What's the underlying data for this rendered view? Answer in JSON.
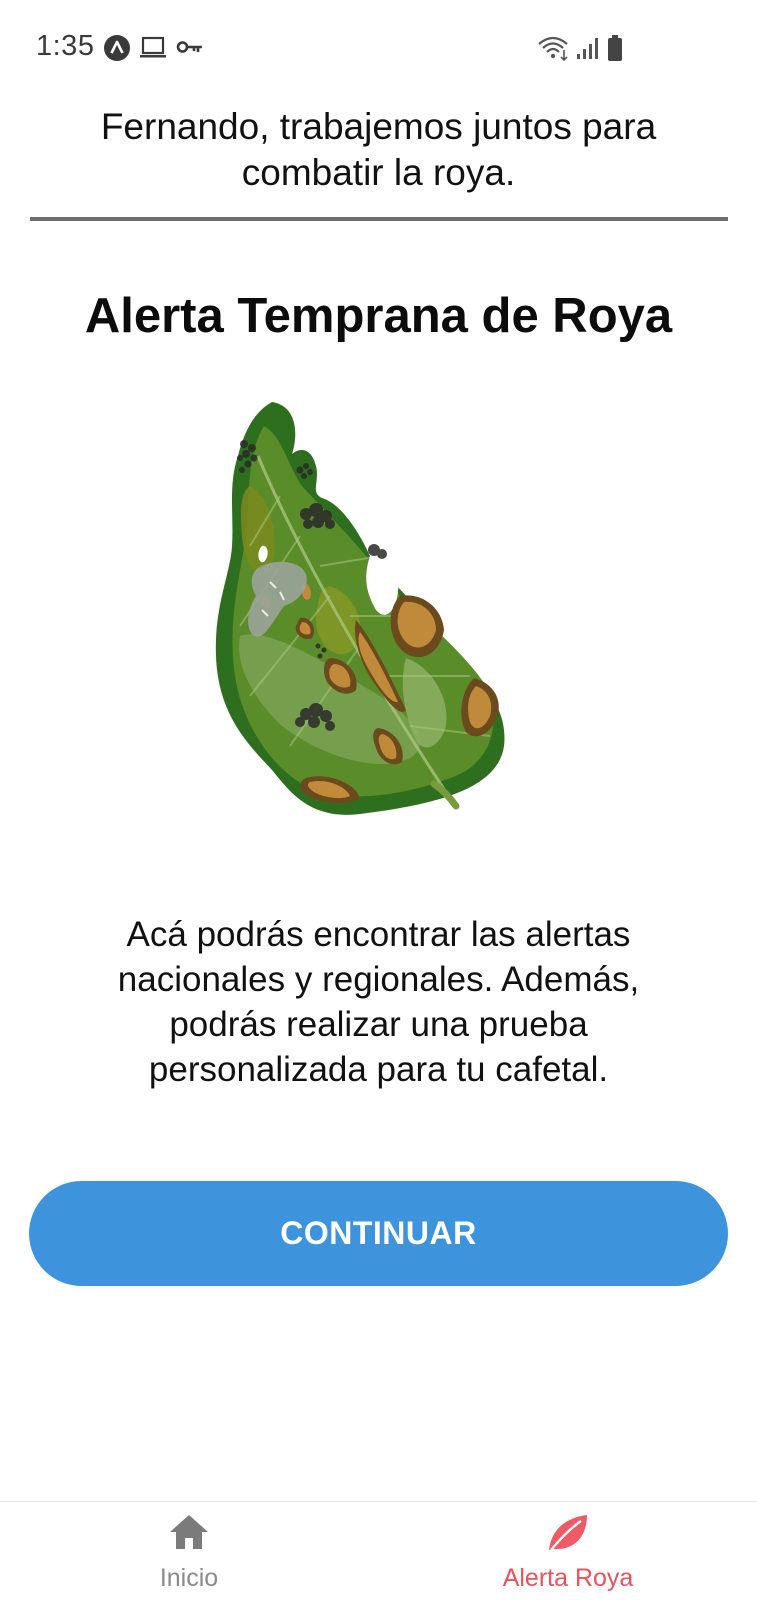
{
  "status_bar": {
    "time": "1:35",
    "icons": [
      "app-notification-icon",
      "laptop-icon",
      "vpn-key-icon",
      "wifi-icon",
      "signal-icon",
      "battery-icon"
    ]
  },
  "header": {
    "greeting": "Fernando, trabajemos juntos para combatir la roya."
  },
  "main": {
    "title": "Alerta Temprana de Roya",
    "illustration_icon": "coffee-leaf-rust-illustration",
    "description": "Acá podrás encontrar las alertas nacionales y regionales. Además, podrás realizar una prueba personalizada para tu cafetal.",
    "continue_label": "CONTINUAR"
  },
  "bottom_nav": {
    "items": [
      {
        "label": "Inicio",
        "icon": "home-icon",
        "active": false
      },
      {
        "label": "Alerta Roya",
        "icon": "leaf-icon",
        "active": true
      }
    ]
  },
  "colors": {
    "accent_button": "#3d94dc",
    "active_tab": "#e8525e",
    "inactive_tab": "#8a8a8a"
  }
}
